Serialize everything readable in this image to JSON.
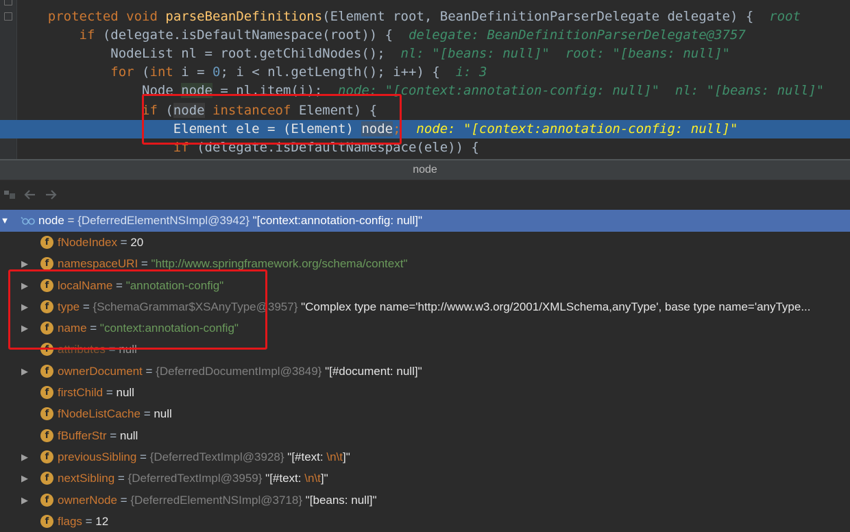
{
  "editor": {
    "lines": [
      [
        {
          "t": "    ",
          "c": "c-default"
        },
        {
          "t": "protected",
          "c": "c-kw"
        },
        {
          "t": " ",
          "c": "c-default"
        },
        {
          "t": "void",
          "c": "c-kw"
        },
        {
          "t": " ",
          "c": "c-default"
        },
        {
          "t": "parseBeanDefinitions",
          "c": "c-fn"
        },
        {
          "t": "(Element root, BeanDefinitionParserDelegate delegate) {  ",
          "c": "c-default"
        },
        {
          "t": "root",
          "c": "c-inline"
        }
      ],
      [
        {
          "t": "        ",
          "c": "c-default"
        },
        {
          "t": "if",
          "c": "c-kw"
        },
        {
          "t": " (delegate.isDefaultNamespace(root)) {  ",
          "c": "c-default"
        },
        {
          "t": "delegate: BeanDefinitionParserDelegate@3757",
          "c": "c-inline"
        }
      ],
      [
        {
          "t": "            NodeList nl = root.getChildNodes();  ",
          "c": "c-default"
        },
        {
          "t": "nl: \"[beans: null]\"  root: \"[beans: null]\"",
          "c": "c-inline"
        }
      ],
      [
        {
          "t": "            ",
          "c": "c-default"
        },
        {
          "t": "for",
          "c": "c-kw"
        },
        {
          "t": " (",
          "c": "c-default"
        },
        {
          "t": "int",
          "c": "c-kw"
        },
        {
          "t": " i = ",
          "c": "c-default"
        },
        {
          "t": "0",
          "c": "c-num"
        },
        {
          "t": "; i < nl.getLength(); i++) {  ",
          "c": "c-default"
        },
        {
          "t": "i: 3",
          "c": "c-inline"
        }
      ],
      [
        {
          "t": "                Node ",
          "c": "c-default"
        },
        {
          "t": "node",
          "c": "c-default c-node-hl"
        },
        {
          "t": " = nl.item(i);  ",
          "c": "c-default"
        },
        {
          "t": "node: \"[context:annotation-config: null]\"  nl: \"[beans: null]\"",
          "c": "c-inline"
        }
      ],
      [
        {
          "t": "                ",
          "c": "c-default"
        },
        {
          "t": "if",
          "c": "c-kw"
        },
        {
          "t": " (",
          "c": "c-default"
        },
        {
          "t": "node",
          "c": "c-default c-var-hl"
        },
        {
          "t": " ",
          "c": "c-default"
        },
        {
          "t": "instanceof",
          "c": "c-kw"
        },
        {
          "t": " Element) {",
          "c": "c-default"
        }
      ],
      [
        {
          "t": "                    Element ele = (Element) ",
          "c": "c-default"
        },
        {
          "t": "node",
          "c": "c-default c-var-hl"
        },
        {
          "t": ";  ",
          "c": "c-kw"
        },
        {
          "t": "node: \"[context:annotation-config: null]\"",
          "c": "c-inline-hl"
        }
      ],
      [
        {
          "t": "                    ",
          "c": "c-default"
        },
        {
          "t": "if",
          "c": "c-kw"
        },
        {
          "t": " (delegate.isDefaultNamespace(ele)) {",
          "c": "c-default"
        }
      ]
    ]
  },
  "panel": {
    "title": "node"
  },
  "tree": [
    {
      "kind": "root",
      "name": "node",
      "ref": "{DeferredElementNSImpl@3942}",
      "desc": "\"[context:annotation-config: null]\""
    },
    {
      "kind": "field",
      "expand": false,
      "name": "fNodeIndex",
      "num": "20"
    },
    {
      "kind": "field",
      "expand": true,
      "name": "namespaceURI",
      "str": "\"http://www.springframework.org/schema/context\""
    },
    {
      "kind": "field",
      "expand": true,
      "name": "localName",
      "str": "\"annotation-config\""
    },
    {
      "kind": "field",
      "expand": true,
      "name": "type",
      "ref": "{SchemaGrammar$XSAnyType@3957}",
      "desc": "\"Complex type name='http://www.w3.org/2001/XMLSchema,anyType',  base type name='anyType..."
    },
    {
      "kind": "field",
      "expand": true,
      "name": "name",
      "str": "\"context:annotation-config\""
    },
    {
      "kind": "field",
      "expand": false,
      "name": "attributes",
      "num": "null",
      "dim": true
    },
    {
      "kind": "field",
      "expand": true,
      "name": "ownerDocument",
      "ref": "{DeferredDocumentImpl@3849}",
      "desc": "\"[#document: null]\""
    },
    {
      "kind": "field",
      "expand": false,
      "name": "firstChild",
      "num": "null"
    },
    {
      "kind": "field",
      "expand": false,
      "name": "fNodeListCache",
      "num": "null"
    },
    {
      "kind": "field",
      "expand": false,
      "name": "fBufferStr",
      "num": "null"
    },
    {
      "kind": "field",
      "expand": true,
      "name": "previousSibling",
      "ref": "{DeferredTextImpl@3928}",
      "descPre": "\"[#text: ",
      "esc": "\\n\\t",
      "descPost": "]\""
    },
    {
      "kind": "field",
      "expand": true,
      "name": "nextSibling",
      "ref": "{DeferredTextImpl@3959}",
      "descPre": "\"[#text: ",
      "esc": "\\n\\t",
      "descPost": "]\""
    },
    {
      "kind": "field",
      "expand": true,
      "name": "ownerNode",
      "ref": "{DeferredElementNSImpl@3718}",
      "desc": "\"[beans: null]\""
    },
    {
      "kind": "field",
      "expand": false,
      "name": "flags",
      "num": "12"
    }
  ],
  "icons": {
    "field_letter": "f",
    "expand_glyph": "▶",
    "collapse_glyph": "▼"
  }
}
